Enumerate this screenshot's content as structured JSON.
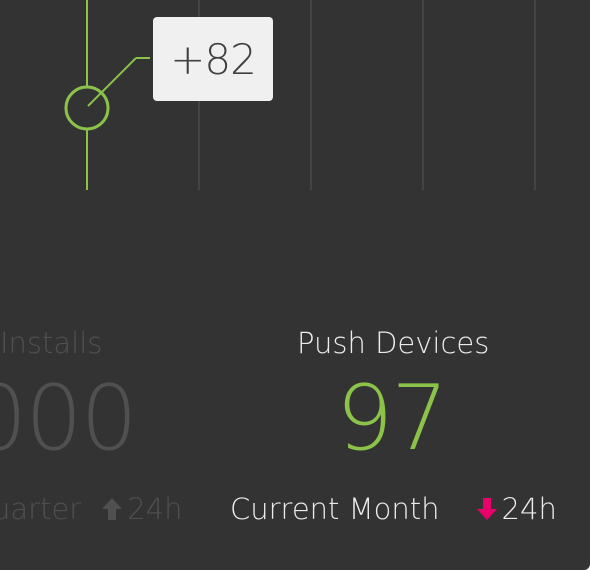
{
  "tooltip": {
    "value": "+82"
  },
  "colors": {
    "accent": "#8bc34a",
    "negative": "#e8006b",
    "background": "#333333",
    "muted": "#505050"
  },
  "stats": {
    "installs": {
      "title": "Installs",
      "value": "000",
      "period": "uarter",
      "trend": "up",
      "trend_icon": "arrow-up-icon",
      "trend_label": "24h"
    },
    "push_devices": {
      "title": "Push Devices",
      "value": "97",
      "period": "Current Month",
      "trend": "down",
      "trend_icon": "arrow-down-icon",
      "trend_label": "24h"
    }
  }
}
